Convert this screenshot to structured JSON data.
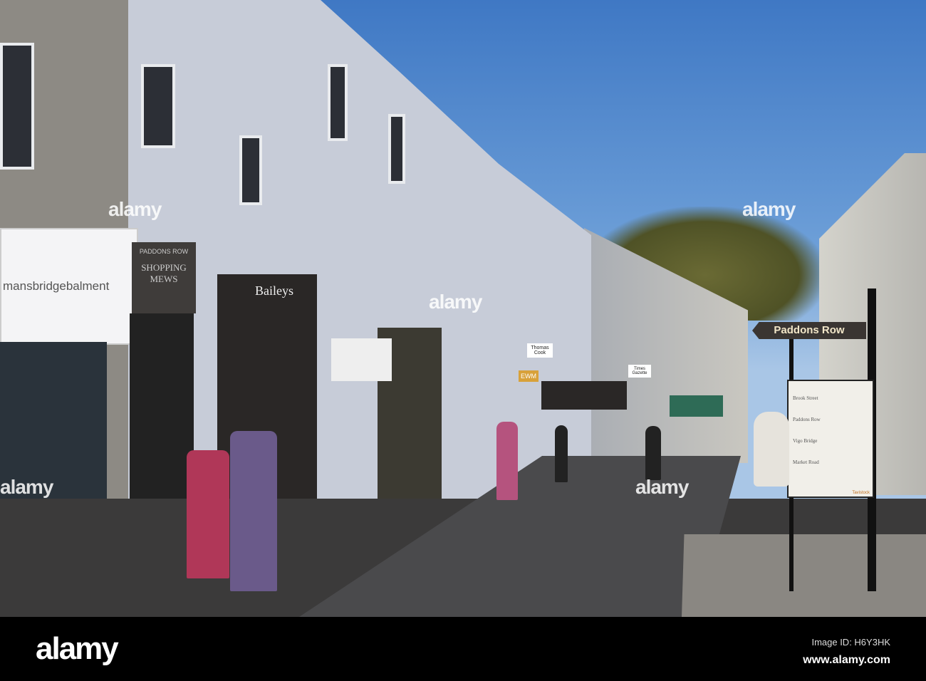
{
  "photo": {
    "agent_sign": "mansbridgebalment",
    "arch_sign": "SHOPPING MEWS",
    "arch_sub": "PADDONS ROW",
    "shop_signs": [
      "Baileys",
      "EWM",
      "Thomas Cook",
      "Times Gazette"
    ],
    "street_sign": "Paddons Row",
    "directory": {
      "sections": [
        "Brook Street",
        "Paddons Row",
        "Vigo Bridge",
        "Market Road"
      ],
      "footer": "Tavistock"
    }
  },
  "watermark": {
    "text": "alamy"
  },
  "footer_bar": {
    "logo": "alamy",
    "image_id": "Image ID: H6Y3HK",
    "url": "www.alamy.com"
  }
}
